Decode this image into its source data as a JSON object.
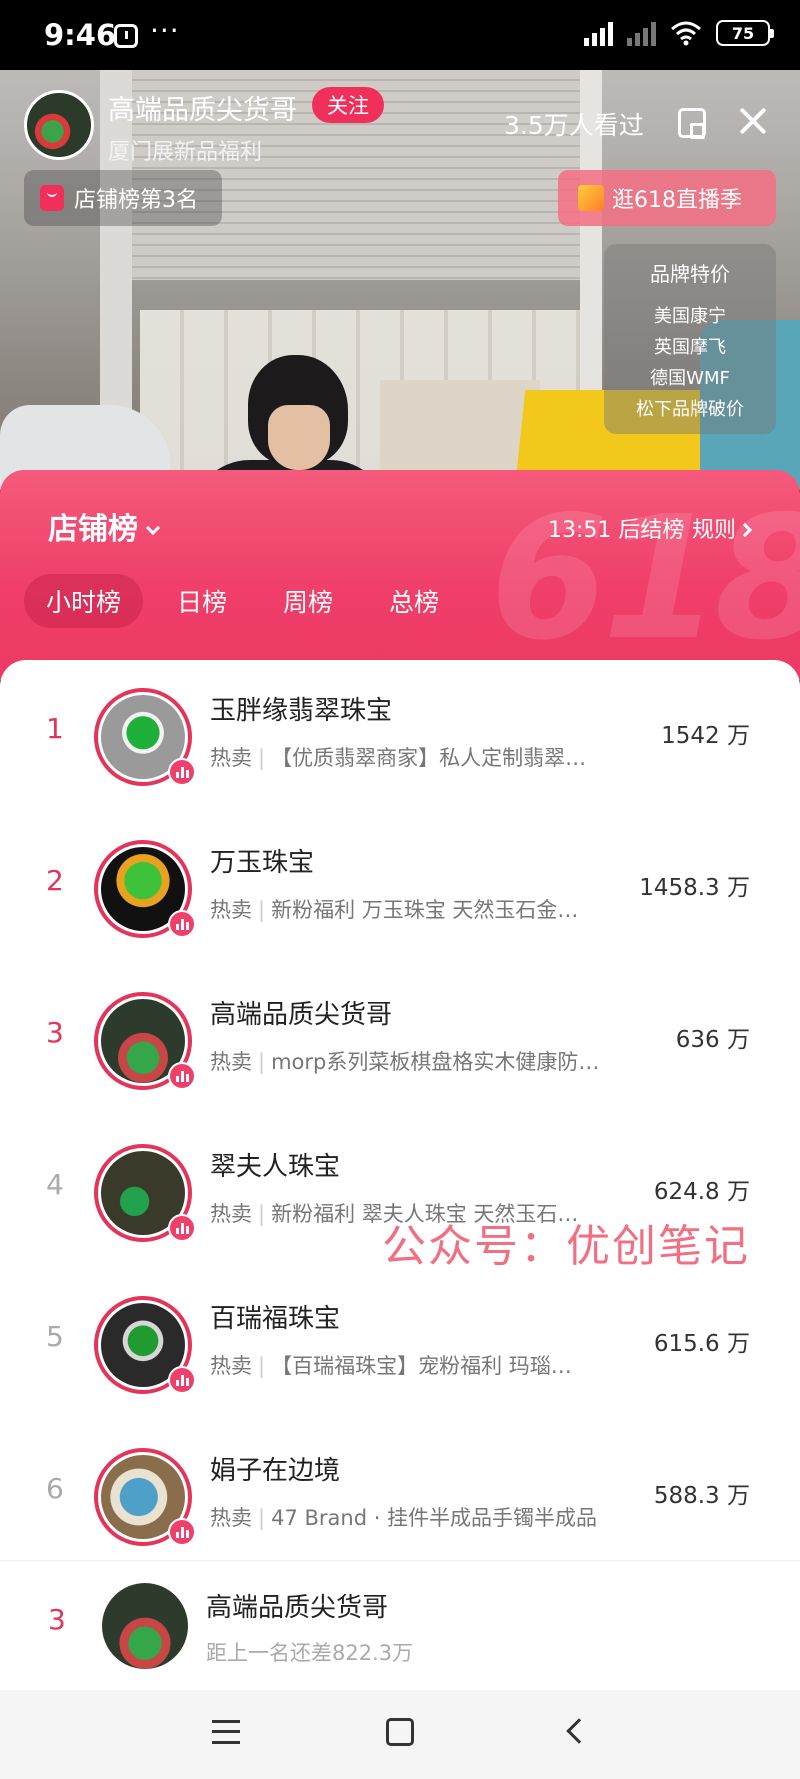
{
  "status_bar": {
    "time": "9:46",
    "dots": "···",
    "battery": "75",
    "icons": [
      "app-icon",
      "hd-signal-icon",
      "signal-icon",
      "wifi-icon",
      "battery-icon"
    ]
  },
  "live": {
    "streamer_name": "高端品质尖货哥",
    "follow_label": "关注",
    "subtitle": "厦门展新品福利",
    "viewers": "3.5万人看过",
    "rank_pill": "店铺榜第3名",
    "promo_pill": "逛618直播季",
    "brand_panel": {
      "title": "品牌特价",
      "items": [
        "美国康宁",
        "英国摩飞",
        "德国WMF",
        "松下品牌破价"
      ]
    }
  },
  "ranking": {
    "title": "店铺榜",
    "countdown": "13:51 后结榜",
    "rules": "规则",
    "watermark": "618",
    "tabs": [
      "小时榜",
      "日榜",
      "周榜",
      "总榜"
    ],
    "active_tab": 0,
    "hot_label": "热卖",
    "rows": [
      {
        "rank": "1",
        "name": "玉胖缘翡翠珠宝",
        "desc": "【优质翡翠商家】私人定制翡翠…",
        "value": "1542 万"
      },
      {
        "rank": "2",
        "name": "万玉珠宝",
        "desc": "新粉福利 万玉珠宝 天然玉石金…",
        "value": "1458.3 万"
      },
      {
        "rank": "3",
        "name": "高端品质尖货哥",
        "desc": "morp系列菜板棋盘格实木健康防…",
        "value": "636 万"
      },
      {
        "rank": "4",
        "name": "翠夫人珠宝",
        "desc": "新粉福利 翠夫人珠宝 天然玉石…",
        "value": "624.8 万"
      },
      {
        "rank": "5",
        "name": "百瑞福珠宝",
        "desc": "【百瑞福珠宝】宠粉福利 玛瑙…",
        "value": "615.6 万"
      },
      {
        "rank": "6",
        "name": "娟子在边境",
        "desc": "47 Brand · 挂件半成品手镯半成品",
        "value": "588.3 万"
      }
    ],
    "own": {
      "rank": "3",
      "name": "高端品质尖货哥",
      "gap": "距上一名还差822.3万"
    }
  },
  "overlay_watermark": "公众号：优创笔记",
  "colors": {
    "accent": "#ef3f6a",
    "rank_top": "#e3345a",
    "rank_other": "#aaaaaa"
  }
}
